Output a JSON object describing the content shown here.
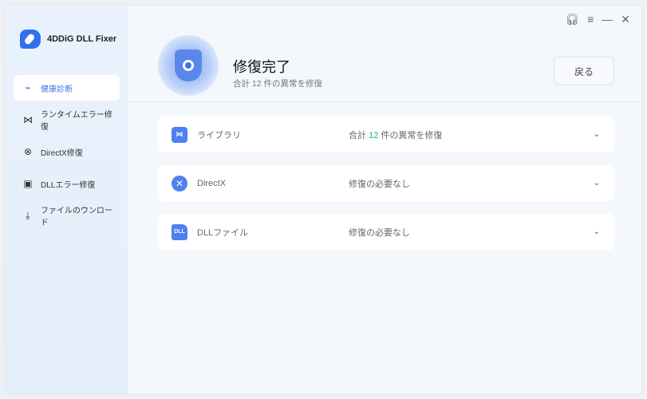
{
  "app": {
    "title": "4DDiG DLL Fixer"
  },
  "sidebar": {
    "items": [
      {
        "label": "健康診断",
        "icon": "monitor-pulse-icon",
        "active": true
      },
      {
        "label": "ランタイムエラー修復",
        "icon": "visual-studio-icon"
      },
      {
        "label": "DirectX修復",
        "icon": "x-circle-icon"
      },
      {
        "label": "DLLエラー修復",
        "icon": "dll-square-icon"
      },
      {
        "label": "ファイルのウンロード",
        "icon": "download-icon"
      }
    ]
  },
  "header": {
    "title": "修復完了",
    "subtitle_prefix": "合計",
    "subtitle_count": "12",
    "subtitle_suffix": "件の異常を修復",
    "back_label": "戻る"
  },
  "rows": [
    {
      "name": "ライブラリ",
      "status_prefix": "合計",
      "status_count": "12",
      "status_suffix": "件の異常を修復"
    },
    {
      "name": "DirectX",
      "status": "修復の必要なし"
    },
    {
      "name": "DLLファイル",
      "status": "修復の必要なし"
    }
  ],
  "icons": {
    "dll_text": "DLL"
  },
  "colors": {
    "accent": "#3b74e8",
    "success": "#1fb58a"
  }
}
